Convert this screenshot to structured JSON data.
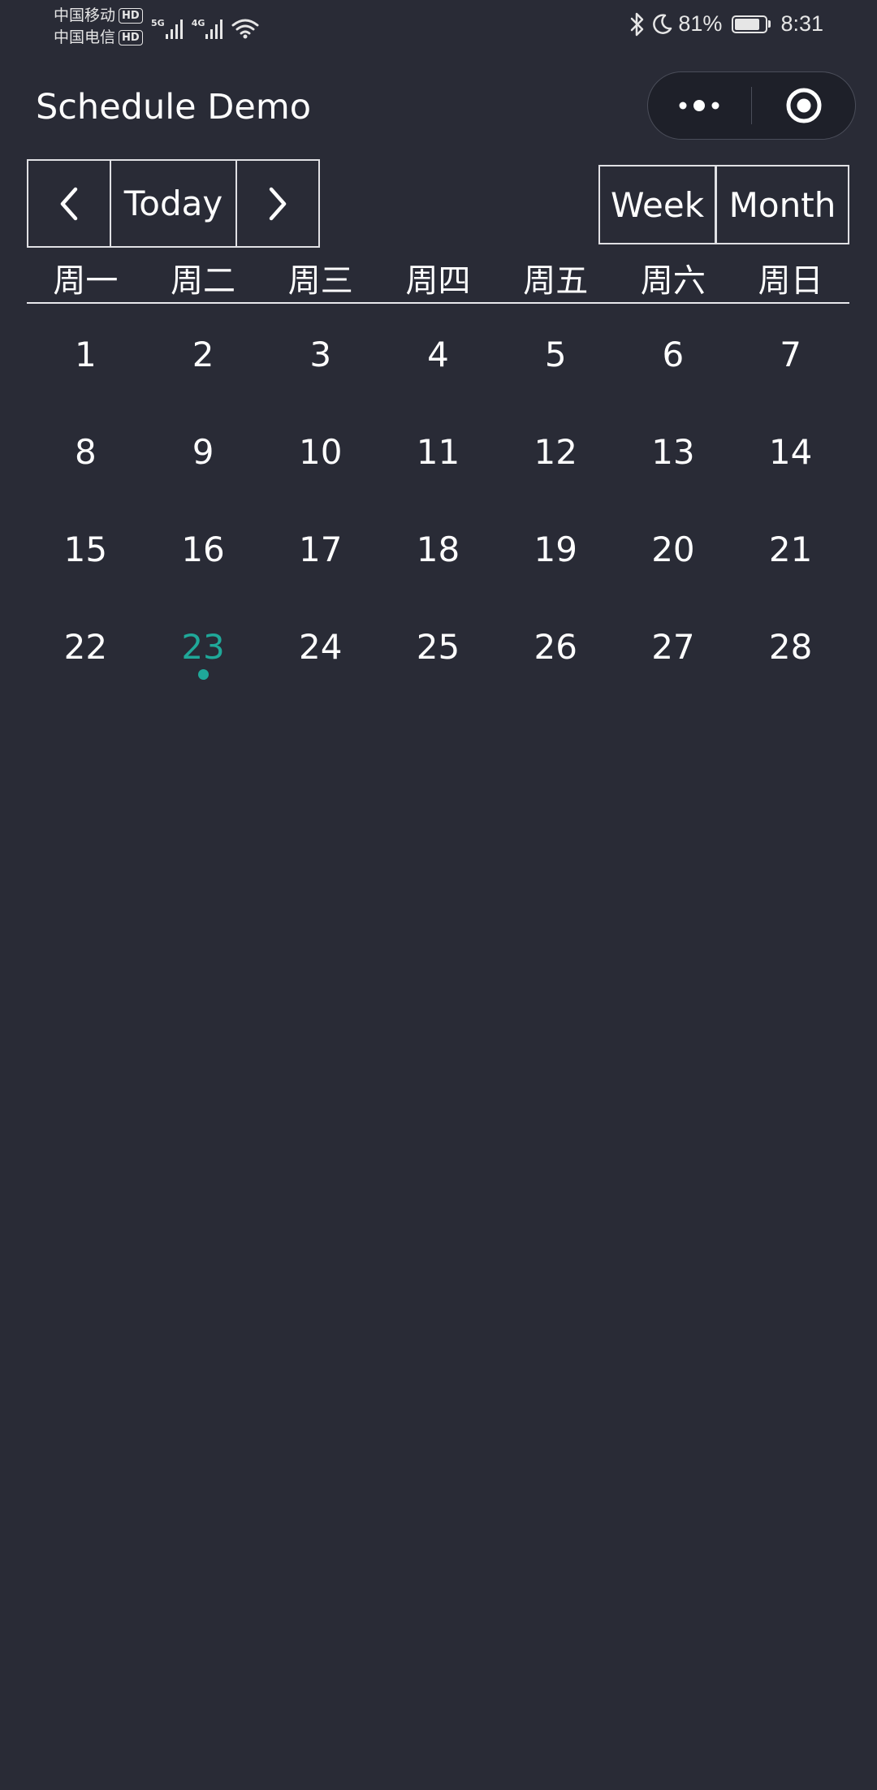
{
  "status_bar": {
    "carrier_1": "中国移动",
    "carrier_2": "中国电信",
    "hd_badge": "HD",
    "network_1": "5G",
    "network_2": "4G",
    "battery_percent": "81%",
    "battery_level": 0.81,
    "time": "8:31"
  },
  "nav": {
    "title": "Schedule Demo",
    "more_icon": "more-dots-icon",
    "close_icon": "record-circle-icon"
  },
  "toolbar": {
    "prev_icon": "chevron-left-icon",
    "today_label": "Today",
    "next_icon": "chevron-right-icon",
    "week_label": "Week",
    "month_label": "Month"
  },
  "calendar": {
    "weekdays": [
      "周一",
      "周二",
      "周三",
      "周四",
      "周五",
      "周六",
      "周日"
    ],
    "days": [
      "1",
      "2",
      "3",
      "4",
      "5",
      "6",
      "7",
      "8",
      "9",
      "10",
      "11",
      "12",
      "13",
      "14",
      "15",
      "16",
      "17",
      "18",
      "19",
      "20",
      "21",
      "22",
      "23",
      "24",
      "25",
      "26",
      "27",
      "28"
    ],
    "today": "23",
    "accent_color": "#1fa899"
  },
  "colors": {
    "background": "#292b36",
    "text": "#ffffff",
    "border": "#e0e0e4"
  }
}
